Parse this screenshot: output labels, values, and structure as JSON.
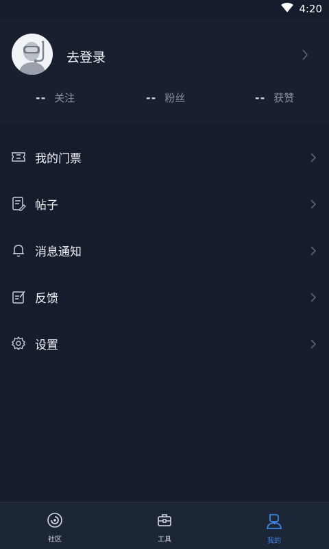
{
  "status_bar": {
    "time": "4:20",
    "wifi_icon": "wifi-icon"
  },
  "profile": {
    "login_text": "去登录",
    "avatar_icon": "diver-avatar-icon",
    "stats": [
      {
        "value": "--",
        "label": "关注"
      },
      {
        "value": "--",
        "label": "粉丝"
      },
      {
        "value": "--",
        "label": "获赞"
      }
    ]
  },
  "menu": {
    "items": [
      {
        "label": "我的门票",
        "icon": "ticket-icon"
      },
      {
        "label": "帖子",
        "icon": "post-icon"
      },
      {
        "label": "消息通知",
        "icon": "bell-icon"
      },
      {
        "label": "反馈",
        "icon": "feedback-icon"
      },
      {
        "label": "设置",
        "icon": "gear-icon"
      }
    ]
  },
  "tabbar": {
    "tabs": [
      {
        "label": "社区",
        "icon": "community-icon",
        "active": false
      },
      {
        "label": "工具",
        "icon": "toolbox-icon",
        "active": false
      },
      {
        "label": "我的",
        "icon": "profile-icon",
        "active": true
      }
    ],
    "active_color": "#3f86e6"
  }
}
